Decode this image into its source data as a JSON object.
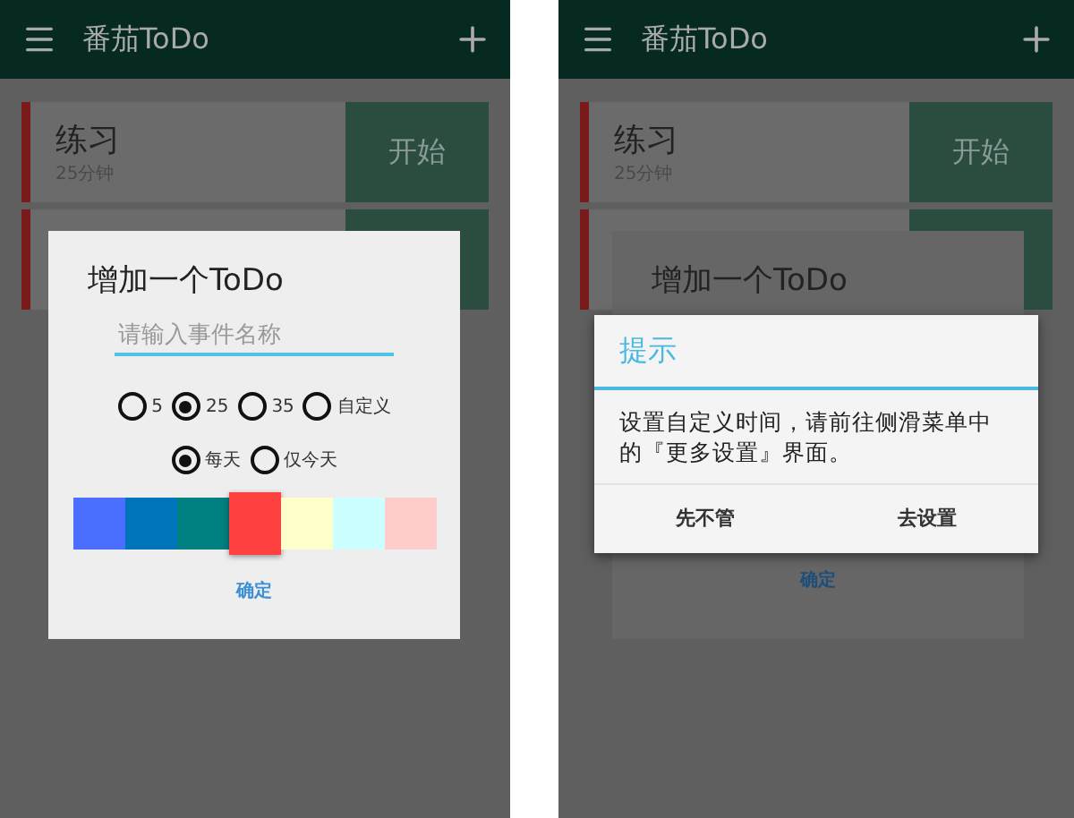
{
  "screens": [
    {
      "kind": "add-dialog",
      "app_bar": {
        "title": "番茄ToDo"
      },
      "todo_cards": [
        {
          "kind": "full",
          "name": "练习",
          "duration": "25分钟",
          "action": "开始"
        },
        {
          "kind": "covered"
        }
      ],
      "dialog": {
        "title": "增加一个ToDo",
        "name_field": {
          "placeholder": "请输入事件名称"
        },
        "duration_options": [
          {
            "label": "5",
            "selected": false
          },
          {
            "label": "25",
            "selected": true
          },
          {
            "label": "35",
            "selected": false
          },
          {
            "label": "自定义",
            "selected": false
          }
        ],
        "repeat_options": [
          {
            "label": "每天",
            "selected": true
          },
          {
            "label": "仅今天",
            "selected": false
          }
        ],
        "colors": [
          {
            "color": "#4a6fff",
            "selected": false
          },
          {
            "color": "#0074bb",
            "selected": false
          },
          {
            "color": "#008080",
            "selected": false
          },
          {
            "color": "#ff4040",
            "selected": true
          },
          {
            "color": "#ffffcc",
            "selected": false
          },
          {
            "color": "#ccffff",
            "selected": false
          },
          {
            "color": "#ffcccc",
            "selected": false
          }
        ],
        "confirm": "确定"
      }
    },
    {
      "kind": "alert",
      "app_bar": {
        "title": "番茄ToDo"
      },
      "todo_cards": [
        {
          "kind": "full",
          "name": "练习",
          "duration": "25分钟",
          "action": "开始"
        },
        {
          "kind": "covered"
        }
      ],
      "background_dialog": {
        "title": "增加一个ToDo",
        "confirm": "确定"
      },
      "alert": {
        "title": "提示",
        "message": "设置自定义时间，请前往侧滑菜单中的『更多设置』界面。",
        "buttons": [
          "先不管",
          "去设置"
        ]
      }
    }
  ]
}
